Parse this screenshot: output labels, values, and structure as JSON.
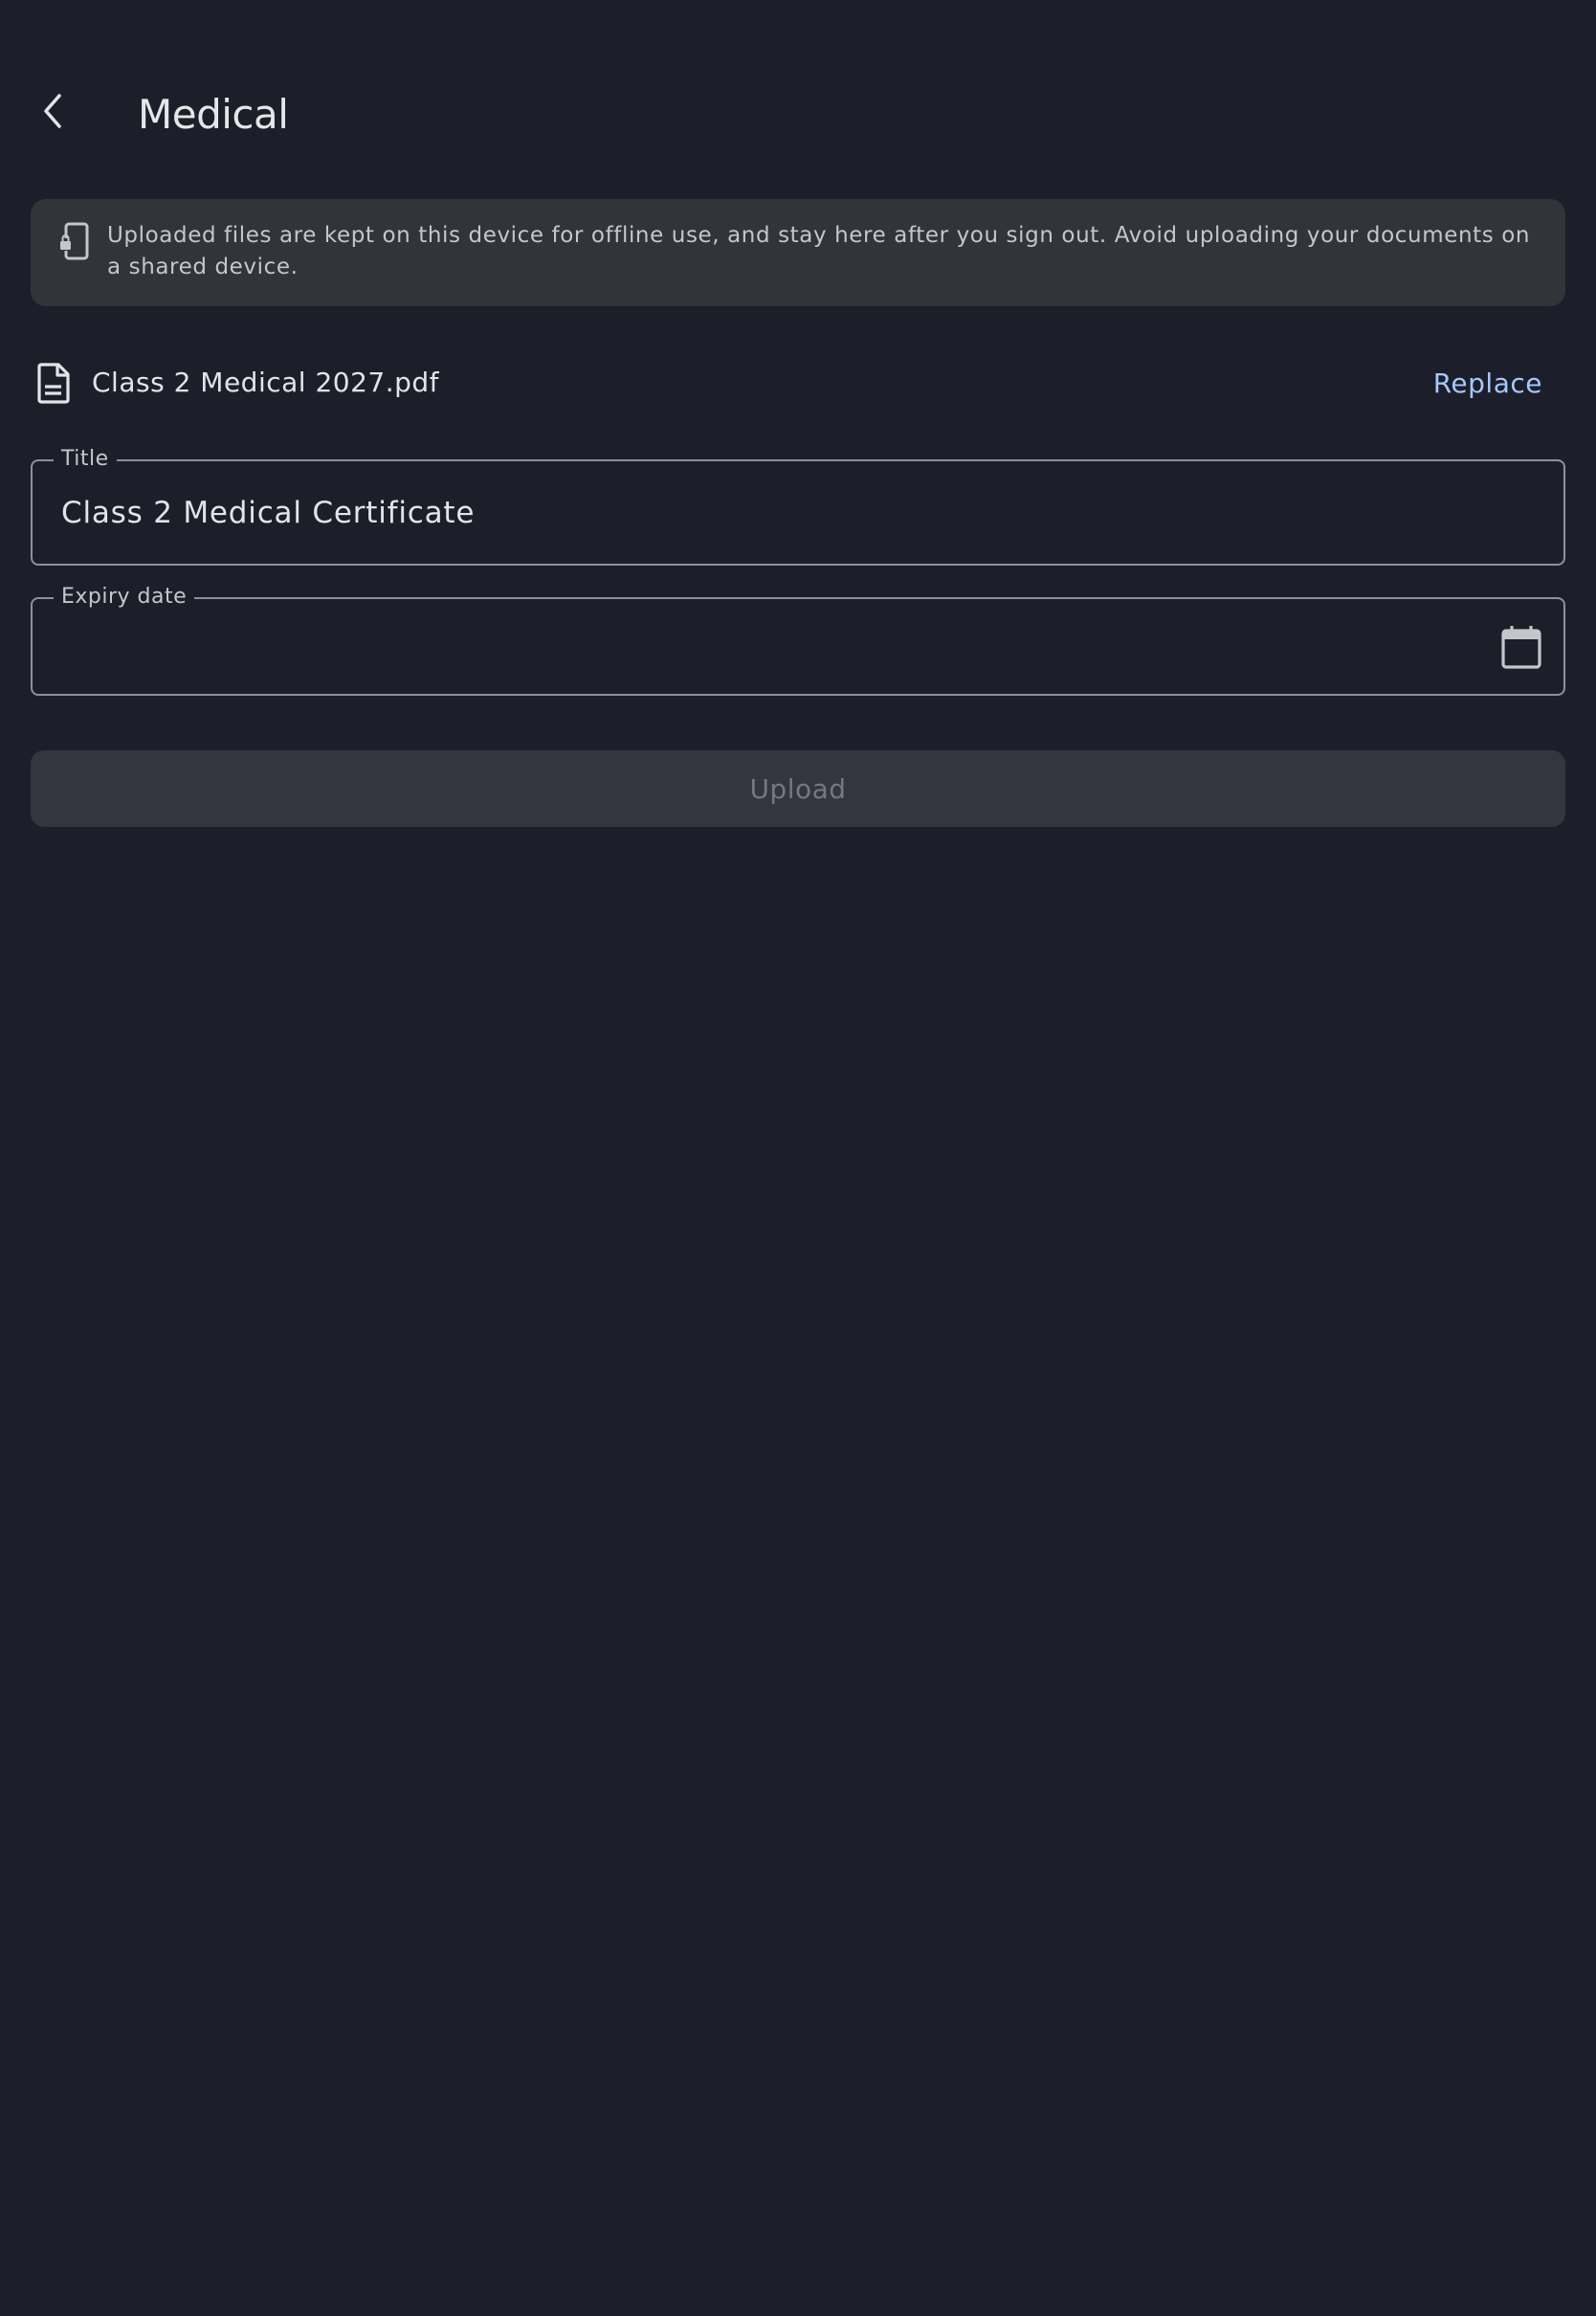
{
  "app_bar": {
    "title": "Medical",
    "back_icon": "arrow-back-icon"
  },
  "notice": {
    "icon": "phone-lock-icon",
    "text": "Uploaded files are kept on this device for offline use, and stay here after you sign out. Avoid uploading your documents on a shared device."
  },
  "file": {
    "icon": "document-icon",
    "name": "Class 2 Medical 2027.pdf",
    "replace_label": "Replace"
  },
  "form": {
    "title": {
      "label": "Title",
      "value": "Class 2 Medical Certificate"
    },
    "expiry": {
      "label": "Expiry date",
      "value": "",
      "icon": "calendar-icon"
    }
  },
  "upload": {
    "label": "Upload",
    "enabled": false
  },
  "colors": {
    "background": "#1c1f29",
    "notice_background": "#333439",
    "accent": "#a6c8ff",
    "outline": "#8e9099",
    "disabled_button": "#33363f",
    "disabled_text": "#76787f"
  }
}
